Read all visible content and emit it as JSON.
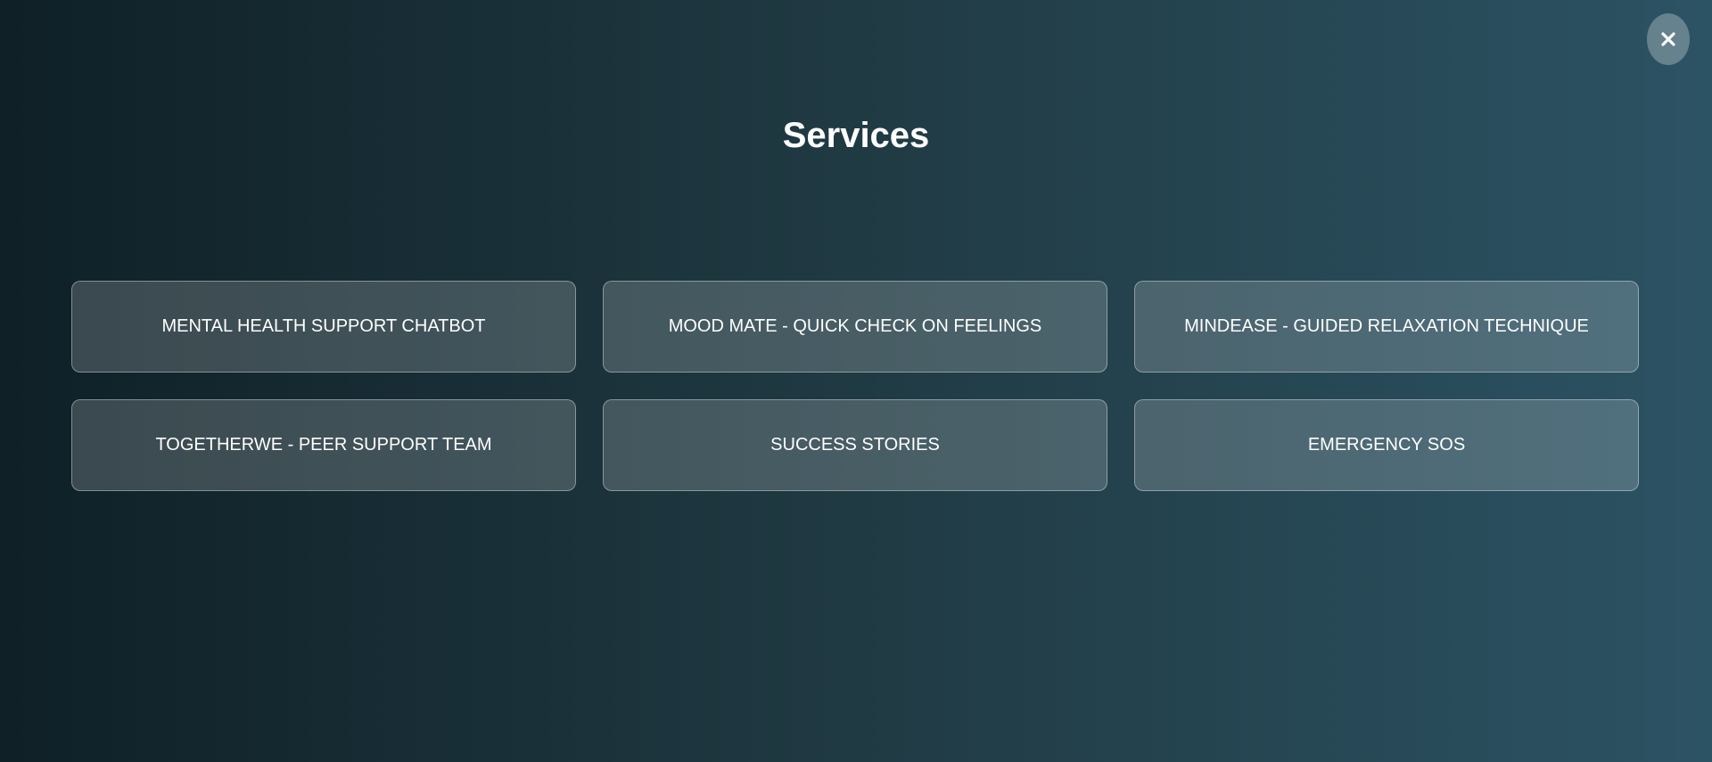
{
  "modal": {
    "title": "Services",
    "close_icon": "close-icon"
  },
  "services": [
    {
      "label": "MENTAL HEALTH SUPPORT CHATBOT"
    },
    {
      "label": "MOOD MATE - QUICK CHECK ON FEELINGS"
    },
    {
      "label": "MINDEASE - GUIDED RELAXATION TECHNIQUE"
    },
    {
      "label": "TOGETHERWE - PEER SUPPORT TEAM"
    },
    {
      "label": "SUCCESS STORIES"
    },
    {
      "label": "EMERGENCY SOS"
    }
  ],
  "colors": {
    "background_start": "#0f2027",
    "background_mid": "#203a43",
    "background_end": "#2c5364",
    "text": "#ffffff"
  }
}
